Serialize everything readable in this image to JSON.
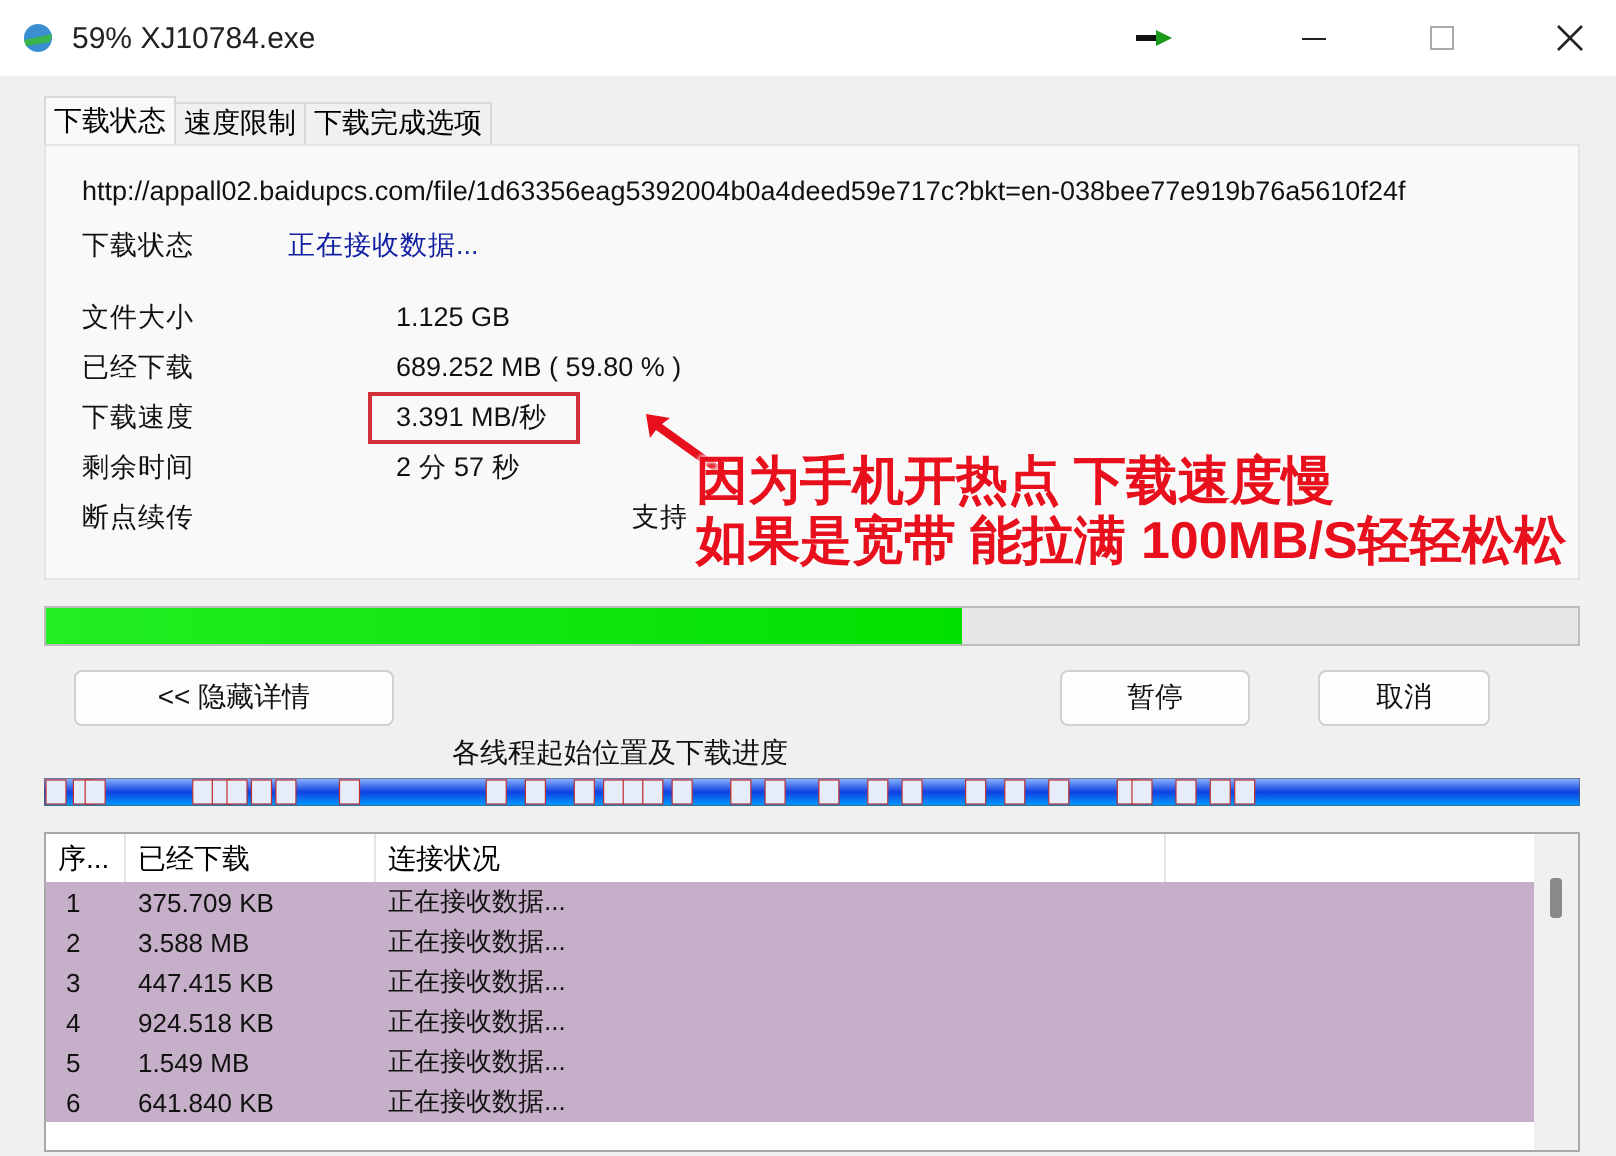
{
  "window": {
    "title": "59% XJ10784.exe"
  },
  "tabs": [
    {
      "label": "下载状态",
      "selected": true
    },
    {
      "label": "速度限制",
      "selected": false
    },
    {
      "label": "下载完成选项",
      "selected": false
    }
  ],
  "url": "http://appall02.baidupcs.com/file/1d63356eag5392004b0a4deed59e717c?bkt=en-038bee77e919b76a5610f24f",
  "status": {
    "label": "下载状态",
    "value": "正在接收数据..."
  },
  "fields": [
    {
      "label": "文件大小",
      "value": "1.125  GB",
      "kind": "value",
      "highlighted": false
    },
    {
      "label": "已经下载",
      "value": "689.252  MB  ( 59.80 % )",
      "kind": "value",
      "highlighted": false
    },
    {
      "label": "下载速度",
      "value": "3.391  MB/秒",
      "kind": "value",
      "highlighted": true
    },
    {
      "label": "剩余时间",
      "value": "2 分 57 秒",
      "kind": "value",
      "highlighted": false
    },
    {
      "label": "断点续传",
      "value": "支持",
      "kind": "flag",
      "highlighted": false
    }
  ],
  "annotation": {
    "lines": [
      "因为手机开热点 下载速度慢",
      "如果是宽带 能拉满 100MB/S轻轻松松"
    ]
  },
  "progress": {
    "level": 0.598
  },
  "buttons": [
    {
      "label": "<< 隐藏详情",
      "kind": "details"
    },
    {
      "label": "暂停",
      "kind": "action"
    },
    {
      "label": "取消",
      "kind": "action"
    }
  ],
  "threads_label": "各线程起始位置及下载进度",
  "table": {
    "columns": [
      "序...",
      "已经下载",
      "连接状况"
    ],
    "rows": [
      {
        "cells": [
          "1",
          "375.709  KB",
          "正在接收数据..."
        ],
        "selected": true
      },
      {
        "cells": [
          "2",
          "3.588  MB",
          "正在接收数据..."
        ],
        "selected": true
      },
      {
        "cells": [
          "3",
          "447.415  KB",
          "正在接收数据..."
        ],
        "selected": true
      },
      {
        "cells": [
          "4",
          "924.518  KB",
          "正在接收数据..."
        ],
        "selected": true
      },
      {
        "cells": [
          "5",
          "1.549  MB",
          "正在接收数据..."
        ],
        "selected": true
      },
      {
        "cells": [
          "6",
          "641.840  KB",
          "正在接收数据..."
        ],
        "selected": true
      }
    ]
  }
}
